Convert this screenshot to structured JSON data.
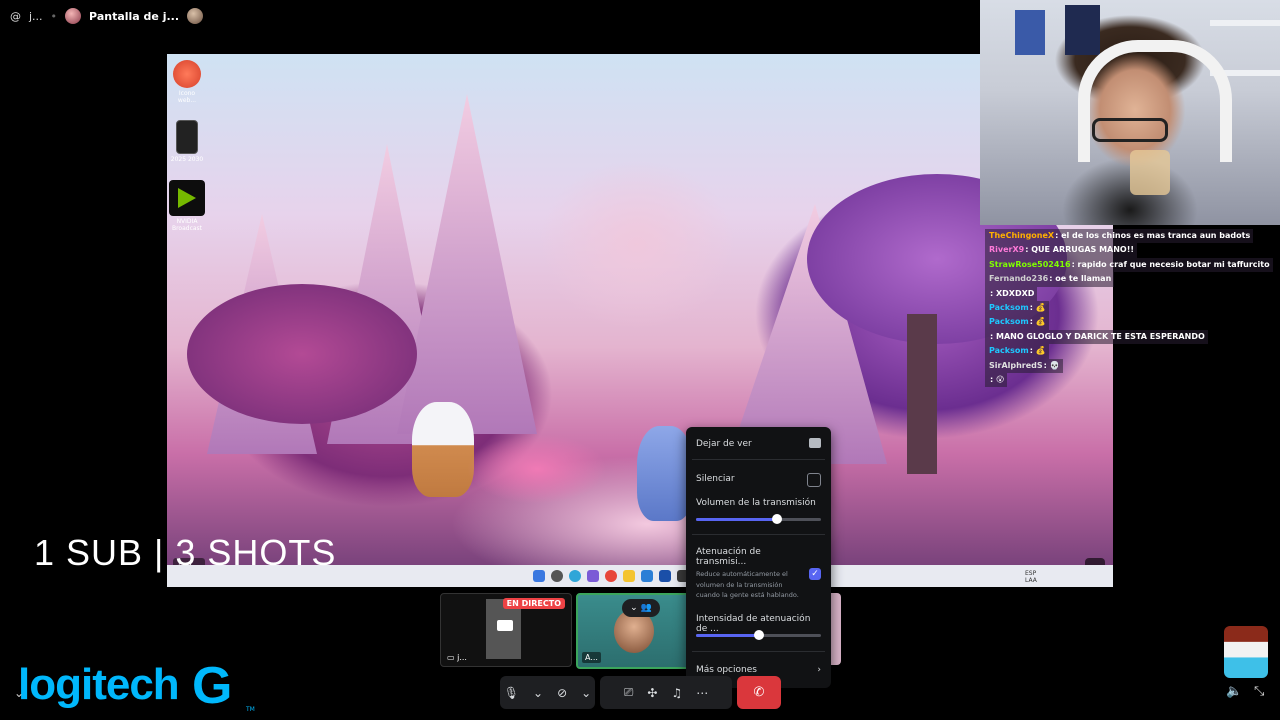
{
  "topbar": {
    "at_symbol": "@",
    "user_short": "j...",
    "stream_title": "Pantalla de j..."
  },
  "desktop": {
    "icons": [
      {
        "label": "Icono web..."
      },
      {
        "label": "2025 2030"
      },
      {
        "label": "NVIDIA Broadcast"
      }
    ],
    "corner_button": "j..."
  },
  "chat": [
    {
      "user": "TheChingoneX",
      "color": "#ffb000",
      "message": "el de los chinos es mas tranca aun badots"
    },
    {
      "user": "RiverX9",
      "color": "#ff7ad9",
      "message": "QUE ARRUGAS MANO!!"
    },
    {
      "user": "StrawRose502416",
      "color": "#7fff00",
      "message": "rapido craf que necesio botar mi taffurcito"
    },
    {
      "user": "Fernando236",
      "color": "#d0d0d0",
      "message": "oe te llaman"
    },
    {
      "user": "",
      "color": "#ff3030",
      "message": "XDXDXD"
    },
    {
      "user": "Packsom",
      "color": "#1ec8ff",
      "message": "💰"
    },
    {
      "user": "Packsom",
      "color": "#1ec8ff",
      "message": "💰"
    },
    {
      "user": "",
      "color": "#1ec8ff",
      "message": "MANO GLOGLO Y DARICK TE ESTA ESPERANDO"
    },
    {
      "user": "Packsom",
      "color": "#1ec8ff",
      "message": "💰"
    },
    {
      "user": "SirAlphredS",
      "color": "#e0e0e0",
      "message": "💀"
    },
    {
      "user": "",
      "color": "#ff3030",
      "message": "😮"
    }
  ],
  "overlay": {
    "sub_text": "1 SUB | 3 SHOTS",
    "logo_text": "logitech",
    "logo_g": "G",
    "logo_tm": "TM"
  },
  "thumbnails": {
    "live_badge": "EN DIRECTO",
    "thumb1_label": "j...",
    "thumb2_label": "A..."
  },
  "menu": {
    "stop_watching": "Dejar de ver",
    "mute": "Silenciar",
    "stream_volume": "Volumen de la transmisión",
    "stream_volume_value": 0.65,
    "attenuation_title": "Atenuación de transmisi...",
    "attenuation_desc": "Reduce automáticamente el volumen de la transmisión cuando la gente está hablando.",
    "attenuation_checked": true,
    "attenuation_intensity": "Intensidad de atenuación de ...",
    "attenuation_intensity_value": 0.5,
    "more_options": "Más opciones"
  },
  "taskbar": {
    "lang": "ESP LAA"
  },
  "colors": {
    "accent": "#5865f2",
    "live_red": "#ed4245",
    "leave_red": "#da373c",
    "logitech_blue": "#00b8fc"
  }
}
